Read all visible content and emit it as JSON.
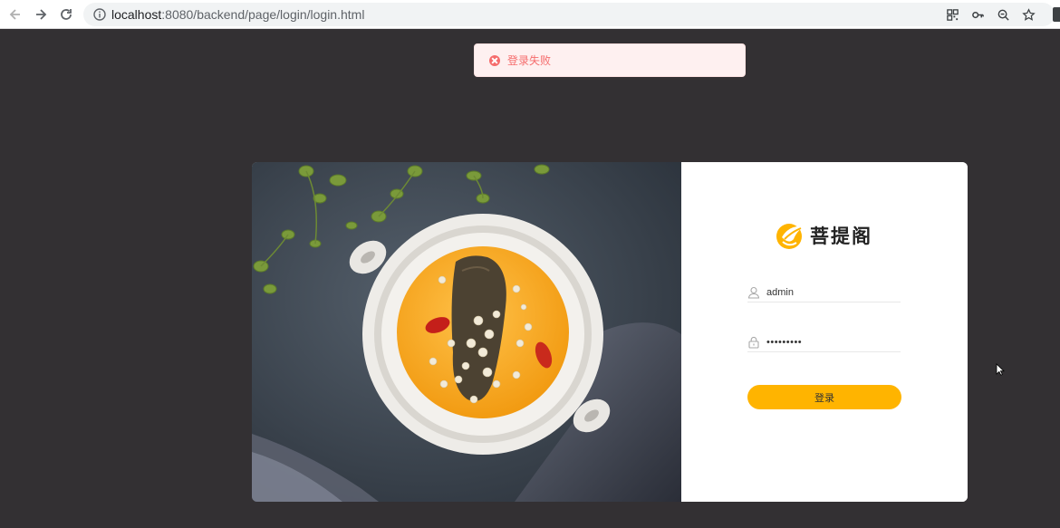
{
  "browser": {
    "url_host": "localhost",
    "url_rest": ":8080/backend/page/login/login.html",
    "toolbar_icons": [
      "back-icon",
      "forward-icon",
      "reload-icon",
      "info-icon",
      "qr-code-icon",
      "key-icon",
      "zoom-out-icon",
      "star-icon"
    ]
  },
  "message": {
    "type": "error",
    "text": "登录失败",
    "color": "#f56c6c"
  },
  "login": {
    "brand_name": "菩提阁",
    "username_value": "admin",
    "password_value": "•••••••••",
    "submit_label": "登录",
    "accent_color": "#ffb400"
  },
  "icons": {
    "user": "user-icon",
    "lock": "lock-icon"
  }
}
